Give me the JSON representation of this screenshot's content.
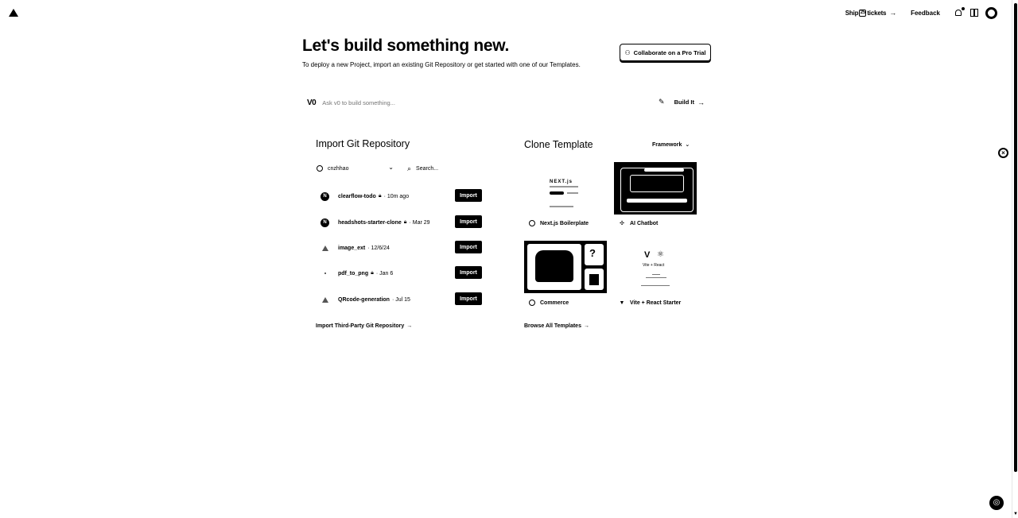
{
  "topbar": {
    "logo": "vercel-logo",
    "ship_prefix": "Ship",
    "ship_glyph": "25",
    "ship_suffix": "tickets",
    "ship_arrow": "→",
    "feedback": "Feedback",
    "icons": [
      "bell-icon",
      "book-icon",
      "avatar"
    ]
  },
  "hero": {
    "title": "Let's build something new.",
    "subtitle": "To deploy a new Project, import an existing Git Repository or get started with one of our Templates.",
    "collab_button": "Collaborate on a Pro Trial"
  },
  "v0": {
    "logo": "V0",
    "placeholder": "Ask v0 to build something...",
    "build_label": "Build It",
    "arrow": "→"
  },
  "import_section": {
    "title": "Import Git Repository",
    "owner": "cnzhhao",
    "search_placeholder": "Search...",
    "import_label": "Import",
    "repos": [
      {
        "name": "clearflow-todo",
        "private": true,
        "date": "· 10m ago",
        "icon": "next"
      },
      {
        "name": "headshots-starter-clone",
        "private": true,
        "date": "· Mar 29",
        "icon": "next"
      },
      {
        "name": "image_ext",
        "private": false,
        "date": "· 12/6/24",
        "icon": "tri"
      },
      {
        "name": "pdf_to_png",
        "private": true,
        "date": "· Jan 6",
        "icon": "dot"
      },
      {
        "name": "QRcode-generation",
        "private": false,
        "date": "· Jul 15",
        "icon": "tri"
      }
    ],
    "third_party": "Import Third-Party Git Repository",
    "third_party_arrow": "→"
  },
  "clone_section": {
    "title": "Clone Template",
    "framework_label": "Framework",
    "templates": [
      {
        "name": "Next.js Boilerplate",
        "icon": "nextjs-icon"
      },
      {
        "name": "AI Chatbot",
        "icon": "ai-chatbot-icon"
      },
      {
        "name": "Commerce",
        "icon": "commerce-icon"
      },
      {
        "name": "Vite + React Starter",
        "icon": "vite-icon"
      }
    ],
    "thumb_text": {
      "next_logo": "NEXT.js",
      "vite_title": "Vite + React"
    },
    "browse_all": "Browse All Templates",
    "browse_arrow": "→"
  }
}
